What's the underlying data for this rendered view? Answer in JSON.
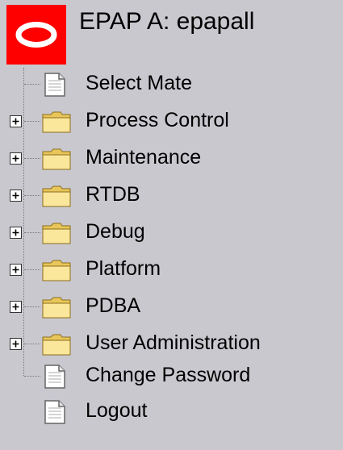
{
  "header": {
    "logo_icon": "oracle-logo-icon",
    "title": "EPAP A: epapall",
    "brand_color": "#ff0000"
  },
  "menu": {
    "items": [
      {
        "label": "Select Mate",
        "type": "page",
        "icon": "page-icon"
      },
      {
        "label": "Process Control",
        "type": "folder",
        "icon": "folder-icon",
        "state": "collapsed"
      },
      {
        "label": "Maintenance",
        "type": "folder",
        "icon": "folder-icon",
        "state": "collapsed"
      },
      {
        "label": "RTDB",
        "type": "folder",
        "icon": "folder-icon",
        "state": "collapsed"
      },
      {
        "label": "Debug",
        "type": "folder",
        "icon": "folder-icon",
        "state": "collapsed"
      },
      {
        "label": "Platform",
        "type": "folder",
        "icon": "folder-icon",
        "state": "collapsed"
      },
      {
        "label": "PDBA",
        "type": "folder",
        "icon": "folder-icon",
        "state": "collapsed"
      },
      {
        "label": "User Administration",
        "type": "folder",
        "icon": "folder-icon",
        "state": "collapsed"
      },
      {
        "label": "Change Password",
        "type": "page",
        "icon": "page-icon"
      },
      {
        "label": "Logout",
        "type": "page",
        "icon": "page-icon"
      }
    ]
  }
}
